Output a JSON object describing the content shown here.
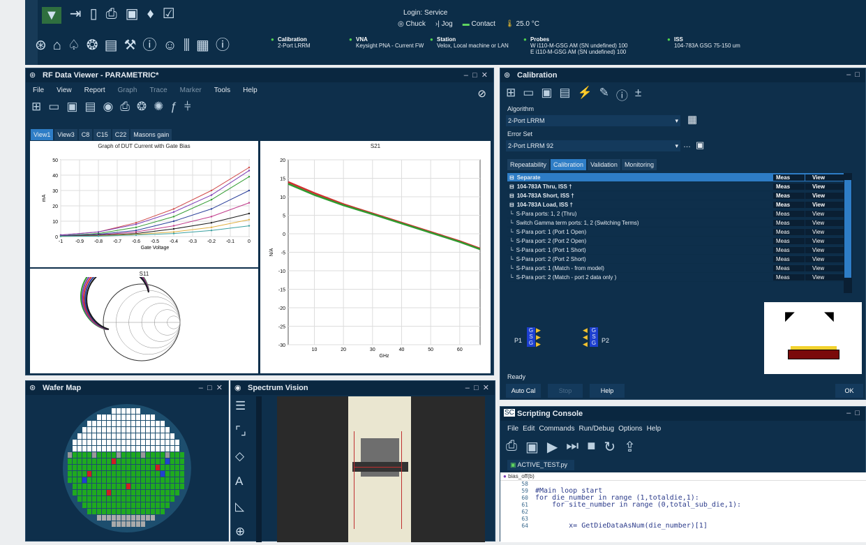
{
  "topbar": {
    "login": "Login: Service",
    "chuck": "Chuck",
    "jog": "Jog",
    "contact": "Contact",
    "temp": "25.0 °C",
    "status": [
      {
        "title": "Calibration",
        "value": "2-Port LRRM"
      },
      {
        "title": "VNA",
        "value": "Keysight PNA - Current FW"
      },
      {
        "title": "Station",
        "value": "Velox, Local machine or LAN"
      },
      {
        "title": "Probes",
        "value": "W i110-M-GSG AM (SN undefined) 100",
        "value2": "E i110-M-GSG AM (SN undefined) 100"
      },
      {
        "title": "ISS",
        "value": "104-783A GSG 75-150 um"
      }
    ],
    "status_color": "#4fd14f"
  },
  "rfviewer": {
    "title": "RF Data Viewer - PARAMETRIC*",
    "menu": [
      "File",
      "View",
      "Report",
      "Graph",
      "Trace",
      "Marker",
      "Tools",
      "Help"
    ],
    "tabs": [
      "View1",
      "View3",
      "C8",
      "C15",
      "C22",
      "Masons gain"
    ],
    "graph1": {
      "title": "Graph of DUT Current with Gate Bias",
      "xlabel": "Gate Voltage",
      "ylabel": "mA",
      "yticks": [
        "50",
        "40",
        "30",
        "20",
        "10",
        "0"
      ],
      "xticks": [
        "-1",
        "-0.9",
        "-0.8",
        "-0.7",
        "-0.6",
        "-0.5",
        "-0.4",
        "-0.3",
        "-0.2",
        "-0.1",
        "0"
      ]
    },
    "graph2": {
      "title": "S21",
      "xlabel": "GHz",
      "ylabel": "N/A",
      "yticks": [
        "20",
        "15",
        "10",
        "5",
        "0",
        "-5",
        "-10",
        "-15",
        "-20",
        "-25",
        "-30"
      ],
      "xticks": [
        "10",
        "20",
        "30",
        "40",
        "50",
        "60"
      ]
    },
    "graph3": {
      "title": "S11"
    }
  },
  "chart_data": [
    {
      "type": "line",
      "title": "Graph of DUT Current with Gate Bias",
      "xlabel": "Gate Voltage",
      "ylabel": "mA",
      "xlim": [
        -1,
        0
      ],
      "ylim": [
        0,
        50
      ],
      "x": [
        -1,
        -0.8,
        -0.6,
        -0.4,
        -0.2,
        0
      ],
      "series": [
        {
          "values": [
            1,
            3,
            9,
            18,
            30,
            45
          ],
          "color": "#d04a4a"
        },
        {
          "values": [
            1,
            3,
            8,
            16,
            27,
            43
          ],
          "color": "#7a3bb5"
        },
        {
          "values": [
            0.5,
            2,
            6,
            13,
            24,
            39
          ],
          "color": "#2f9a2f"
        },
        {
          "values": [
            0.5,
            1.5,
            4,
            10,
            18,
            30
          ],
          "color": "#2a3f9a"
        },
        {
          "values": [
            0.3,
            1,
            3,
            7,
            13,
            22
          ],
          "color": "#c03a8a"
        },
        {
          "values": [
            0.2,
            0.8,
            2,
            5,
            9,
            15
          ],
          "color": "#1a1a1a"
        },
        {
          "values": [
            0.1,
            0.5,
            1.5,
            3,
            6,
            11
          ],
          "color": "#e0b040"
        },
        {
          "values": [
            0.1,
            0.3,
            1,
            2,
            4,
            7
          ],
          "color": "#3aa0a0"
        }
      ]
    },
    {
      "type": "line",
      "title": "S21",
      "xlabel": "GHz",
      "ylabel": "N/A",
      "xlim": [
        1,
        67
      ],
      "ylim": [
        -30,
        20
      ],
      "x": [
        1,
        10,
        20,
        30,
        40,
        50,
        60,
        67
      ],
      "series": [
        {
          "values": [
            14,
            11,
            8,
            5.5,
            3,
            0.5,
            -2,
            -4
          ],
          "color": "#d03030"
        },
        {
          "values": [
            13.5,
            10.5,
            7.7,
            5.3,
            2.8,
            0.3,
            -2.2,
            -4.2
          ],
          "color": "#2f9a2f"
        }
      ]
    }
  ],
  "calibration": {
    "title": "Calibration",
    "algorithm_label": "Algorithm",
    "algorithm": "2-Port LRRM",
    "errorset_label": "Error Set",
    "errorset": "2-Port LRRM 92",
    "tabs": [
      "Repeatability",
      "Calibration",
      "Validation",
      "Monitoring"
    ],
    "rows": [
      {
        "name": "Separate",
        "meas": "Meas",
        "view": "View",
        "bold": true,
        "sel": true
      },
      {
        "name": "104-783A Thru, ISS †",
        "meas": "Meas",
        "view": "View",
        "bold": true
      },
      {
        "name": "104-783A Short, ISS †",
        "meas": "Meas",
        "view": "View",
        "bold": true
      },
      {
        "name": "104-783A Load, ISS †",
        "meas": "Meas",
        "view": "View",
        "bold": true
      },
      {
        "name": "S-Para ports: 1, 2 (Thru)",
        "meas": "Meas",
        "view": "View"
      },
      {
        "name": "Switch Gamma term ports: 1, 2 (Switching Terms)",
        "meas": "Meas",
        "view": "View"
      },
      {
        "name": "S-Para port: 1 (Port 1 Open)",
        "meas": "Meas",
        "view": "View"
      },
      {
        "name": "S-Para port: 2 (Port 2 Open)",
        "meas": "Meas",
        "view": "View"
      },
      {
        "name": "S-Para port: 1 (Port 1 Short)",
        "meas": "Meas",
        "view": "View"
      },
      {
        "name": "S-Para port: 2 (Port 2 Short)",
        "meas": "Meas",
        "view": "View"
      },
      {
        "name": "S-Para port: 1 (Match - from model)",
        "meas": "Meas",
        "view": "View"
      },
      {
        "name": "S-Para port: 2 (Match - port 2 data only )",
        "meas": "Meas",
        "view": "View"
      }
    ],
    "p1": "P1",
    "p2": "P2",
    "gsg": [
      "G",
      "S",
      "G"
    ],
    "sub1": "1",
    "ready": "Ready",
    "autocal": "Auto Cal",
    "stop": "Stop",
    "help": "Help",
    "ok": "OK"
  },
  "wafer": {
    "title": "Wafer Map"
  },
  "spectrum": {
    "title": "Spectrum Vision"
  },
  "script": {
    "title": "Scripting Console",
    "menu": [
      "File",
      "Edit",
      "Commands",
      "Run/Debug",
      "Options",
      "Help"
    ],
    "tab": "ACTIVE_TEST.py",
    "func": "bias_off(b)",
    "lines": [
      {
        "n": "58",
        "t": ""
      },
      {
        "n": "59",
        "t": "#Main loop start"
      },
      {
        "n": "60",
        "t": "for die_number in range (1,totaldie,1):"
      },
      {
        "n": "61",
        "t": "    for site_number in range (0,total_sub_die,1):"
      },
      {
        "n": "62",
        "t": ""
      },
      {
        "n": "63",
        "t": ""
      },
      {
        "n": "64",
        "t": "        x= GetDieDataAsNum(die_number)[1]"
      }
    ]
  }
}
